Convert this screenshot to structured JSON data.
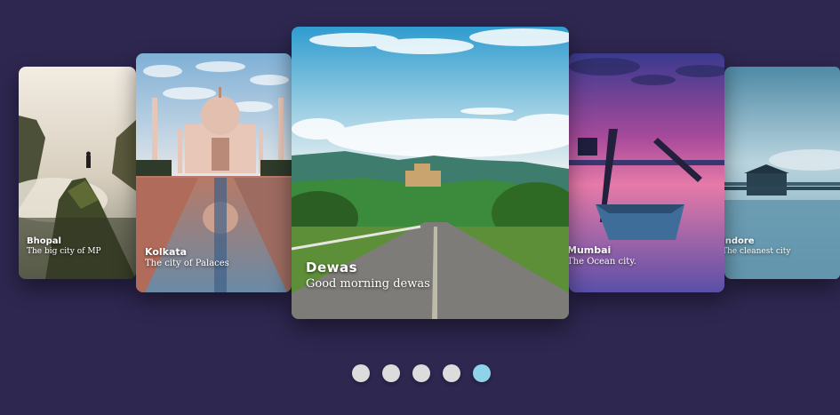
{
  "slides": [
    {
      "title": "Bhopal",
      "subtitle": "The big city of MP",
      "scene": "misty-mountain-hiker"
    },
    {
      "title": "Kolkata",
      "subtitle": "The city of Palaces",
      "scene": "palace-reflection-pool"
    },
    {
      "title": "Dewas",
      "subtitle": "Good morning dewas",
      "scene": "road-to-hill-temple"
    },
    {
      "title": "Mumbai",
      "subtitle": "The Ocean city.",
      "scene": "boat-at-sunset"
    },
    {
      "title": "Indore",
      "subtitle": "The cleanest city",
      "scene": "pier-hut-on-lake"
    }
  ],
  "pagination": {
    "count": 5,
    "active_index": 4
  },
  "colors": {
    "background": "#2e2750",
    "dot": "#dcdcdc",
    "dot_active": "#8fd3ea"
  }
}
